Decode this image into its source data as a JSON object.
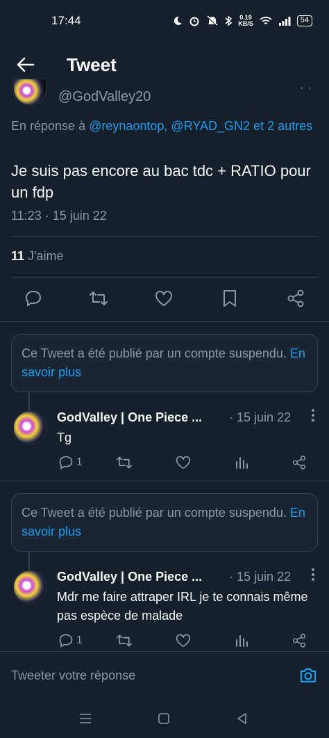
{
  "status_bar": {
    "time": "17:44",
    "net_speed_value": "0.19",
    "net_speed_unit": "KB/S",
    "battery": "54"
  },
  "header": {
    "title": "Tweet"
  },
  "main_tweet": {
    "handle": "@GodValley20",
    "reply_prefix": "En réponse à ",
    "reply_mentions": "@reynaontop, @RYAD_GN2 et 2 autres",
    "text": "Je suis pas encore au bac tdc + RATIO pour un fdp",
    "time": "11:23 · 15 juin 22",
    "likes_count": "11",
    "likes_label": " J'aime"
  },
  "suspended_notices": [
    {
      "text": "Ce Tweet a été publié par un compte suspendu. ",
      "link": "En savoir plus"
    },
    {
      "text": "Ce Tweet a été publié par un compte suspendu. ",
      "link": "En savoir plus"
    }
  ],
  "replies": [
    {
      "name": "GodValley | One Piece ...",
      "date": "· 15 juin 22",
      "text": "Tg",
      "reply_count": "1"
    },
    {
      "name": "GodValley | One Piece ...",
      "date": "· 15 juin 22",
      "text": "Mdr me faire attraper IRL je te connais même pas espèce de malade",
      "reply_count": "1"
    }
  ],
  "compose": {
    "placeholder": "Tweeter votre réponse"
  },
  "colors": {
    "background": "#15202b",
    "accent": "#1d9bf0",
    "muted": "#8b98a5",
    "border": "#38444d"
  },
  "icons": [
    "back-arrow-icon",
    "reply-icon",
    "retweet-icon",
    "like-icon",
    "bookmark-icon",
    "share-icon",
    "views-icon",
    "camera-icon",
    "menu-icon",
    "home-icon",
    "back-triangle-icon"
  ]
}
